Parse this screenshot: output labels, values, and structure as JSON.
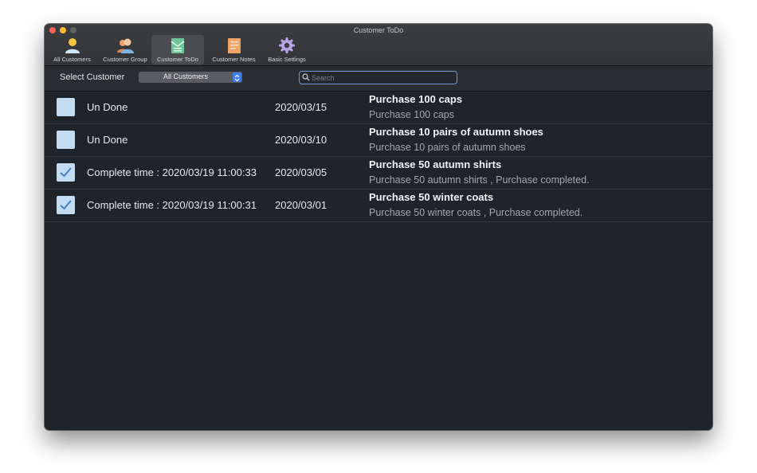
{
  "window": {
    "title": "Customer ToDo"
  },
  "toolbar": {
    "items": [
      {
        "label": "All Customers",
        "icon": "person-icon"
      },
      {
        "label": "Customer Group",
        "icon": "group-icon"
      },
      {
        "label": "Customer ToDo",
        "icon": "todo-envelope-icon",
        "active": true
      },
      {
        "label": "Customer Notes",
        "icon": "notes-icon"
      },
      {
        "label": "Basic Settings",
        "icon": "gear-icon"
      }
    ]
  },
  "filter": {
    "label": "Select Customer",
    "selected": "All Customers",
    "search_placeholder": "Search",
    "search_value": ""
  },
  "todos": [
    {
      "done": false,
      "status": "Un Done",
      "date": "2020/03/15",
      "title": "Purchase 100 caps",
      "description": "Purchase 100 caps"
    },
    {
      "done": false,
      "status": "Un Done",
      "date": "2020/03/10",
      "title": "Purchase 10 pairs of autumn shoes",
      "description": "Purchase 10 pairs of autumn shoes"
    },
    {
      "done": true,
      "status": "Complete time : 2020/03/19 11:00:33",
      "date": "2020/03/05",
      "title": "Purchase 50 autumn shirts",
      "description": "Purchase 50 autumn shirts , Purchase completed."
    },
    {
      "done": true,
      "status": "Complete time : 2020/03/19 11:00:31",
      "date": "2020/03/01",
      "title": "Purchase 50 winter coats",
      "description": "Purchase 50 winter coats , Purchase completed."
    }
  ],
  "colors": {
    "background": "#1f232a",
    "checkbox": "#c2dcf3",
    "check_mark": "#4a7fc0",
    "accent": "#3f7ee8"
  }
}
